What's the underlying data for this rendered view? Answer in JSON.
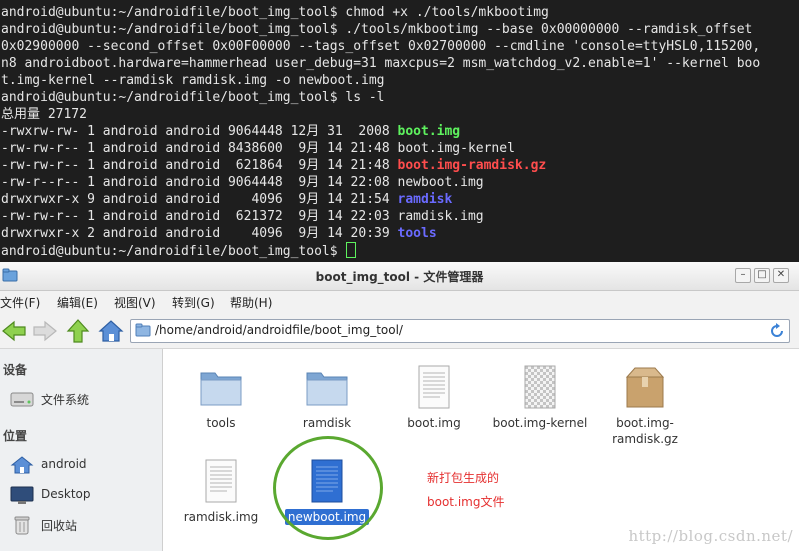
{
  "terminal": {
    "lines": [
      [
        {
          "t": "android@ubuntu:~/androidfile/boot_img_tool$ chmod +x ./tools/mkbootimg"
        }
      ],
      [
        {
          "t": "android@ubuntu:~/androidfile/boot_img_tool$ ./tools/mkbootimg --base 0x00000000 --ramdisk_offset"
        }
      ],
      [
        {
          "t": "0x02900000 --second_offset 0x00F00000 --tags_offset 0x02700000 --cmdline 'console=ttyHSL0,115200,"
        }
      ],
      [
        {
          "t": "n8 androidboot.hardware=hammerhead user_debug=31 maxcpus=2 msm_watchdog_v2.enable=1' --kernel boo"
        }
      ],
      [
        {
          "t": "t.img-kernel --ramdisk ramdisk.img -o newboot.img"
        }
      ],
      [
        {
          "t": "android@ubuntu:~/androidfile/boot_img_tool$ ls -l"
        }
      ],
      [
        {
          "t": "总用量 27172"
        }
      ],
      [
        {
          "t": "-rwxrw-rw- 1 android android 9064448 12月 31  2008 "
        },
        {
          "t": "boot.img",
          "c": "green"
        }
      ],
      [
        {
          "t": "-rw-rw-r-- 1 android android 8438600  9月 14 21:48 boot.img-kernel"
        }
      ],
      [
        {
          "t": "-rw-rw-r-- 1 android android  621864  9月 14 21:48 "
        },
        {
          "t": "boot.img-ramdisk.gz",
          "c": "red"
        }
      ],
      [
        {
          "t": "-rw-r--r-- 1 android android 9064448  9月 14 22:08 newboot.img"
        }
      ],
      [
        {
          "t": "drwxrwxr-x 9 android android    4096  9月 14 21:54 "
        },
        {
          "t": "ramdisk",
          "c": "blue"
        }
      ],
      [
        {
          "t": "-rw-rw-r-- 1 android android  621372  9月 14 22:03 ramdisk.img"
        }
      ],
      [
        {
          "t": "drwxrwxr-x 2 android android    4096  9月 14 20:39 "
        },
        {
          "t": "tools",
          "c": "blue"
        }
      ],
      [
        {
          "t": "android@ubuntu:~/androidfile/boot_img_tool$ "
        },
        {
          "t": "",
          "c": "cursor"
        }
      ]
    ]
  },
  "window": {
    "title": "boot_img_tool - 文件管理器",
    "buttons": {
      "minimize": "–",
      "maximize": "□",
      "close": "✕"
    }
  },
  "menu": [
    "文件(F)",
    "编辑(E)",
    "视图(V)",
    "转到(G)",
    "帮助(H)"
  ],
  "path": "/home/android/androidfile/boot_img_tool/",
  "sidebar": {
    "devices_heading": "设备",
    "devices": [
      {
        "label": "文件系统",
        "icon": "drive-icon"
      }
    ],
    "places_heading": "位置",
    "places": [
      {
        "label": "android",
        "icon": "home-icon"
      },
      {
        "label": "Desktop",
        "icon": "desktop-icon"
      },
      {
        "label": "回收站",
        "icon": "trash-icon"
      }
    ]
  },
  "files": [
    {
      "name": "tools",
      "icon": "folder-icon"
    },
    {
      "name": "ramdisk",
      "icon": "folder-icon"
    },
    {
      "name": "boot.img",
      "icon": "text-file-icon"
    },
    {
      "name": "boot.img-kernel",
      "icon": "binary-file-icon"
    },
    {
      "name": "boot.img-\nramdisk.gz",
      "icon": "archive-icon"
    },
    {
      "name": "ramdisk.img",
      "icon": "text-file-icon"
    },
    {
      "name": "newboot.img",
      "icon": "selected-file-icon",
      "selected": true
    }
  ],
  "annotation": {
    "line1": "新打包生成的",
    "line2": "boot.img文件"
  },
  "watermark": "http://blog.csdn.net/",
  "colors": {
    "accent": "#2f6fd2",
    "annotation": "#e53030",
    "ring": "#5aa830"
  }
}
